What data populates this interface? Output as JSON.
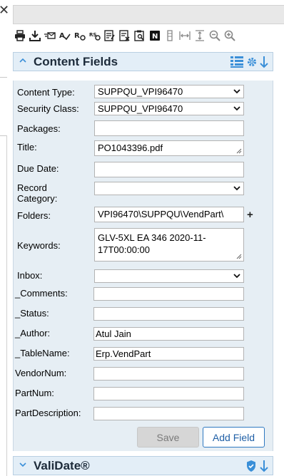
{
  "window": {
    "close_glyph": "✕"
  },
  "toolbar": {
    "icons": [
      "print-icon",
      "download-icon",
      "email-icon",
      "spellcheck-icon",
      "redirect-icon",
      "route-icon",
      "form-icon",
      "close-form-icon",
      "clipboard-search-icon",
      "notes-icon",
      "column-icon",
      "fit-width-icon",
      "fit-height-icon",
      "zoom-out-icon",
      "zoom-in-icon"
    ]
  },
  "content_fields": {
    "title": "Content Fields",
    "chev": "^",
    "fields": {
      "content_type": {
        "label": "Content Type:",
        "value": "SUPPQU_VPI96470"
      },
      "security_class": {
        "label": "Security Class:",
        "value": "SUPPQU_VPI96470"
      },
      "packages": {
        "label": "Packages:",
        "value": ""
      },
      "title": {
        "label": "Title:",
        "value": "PO1043396.pdf"
      },
      "due_date": {
        "label": "Due Date:",
        "value": ""
      },
      "record_category": {
        "label_1": "Record",
        "label_2": "Category:",
        "value": ""
      },
      "folders": {
        "label": "Folders:",
        "value": "VPI96470\\SUPPQU\\VendPart\\",
        "add": "+"
      },
      "keywords": {
        "label": "Keywords:",
        "line_1": "GLV-5XL  EA 346 2020-11-",
        "line_2": "17T00:00:00"
      },
      "inbox": {
        "label": "Inbox:",
        "value": ""
      },
      "comments": {
        "label": "_Comments:",
        "value": ""
      },
      "status": {
        "label": "_Status:",
        "value": ""
      },
      "author": {
        "label": "_Author:",
        "value": "Atul Jain"
      },
      "table_name": {
        "label": "_TableName:",
        "value": "Erp.VendPart"
      },
      "vendor_num": {
        "label": "VendorNum:",
        "value": ""
      },
      "part_num": {
        "label": "PartNum:",
        "value": ""
      },
      "part_description": {
        "label": "PartDescription:",
        "value": ""
      }
    },
    "buttons": {
      "save": "Save",
      "add_field": "Add Field"
    }
  },
  "validate": {
    "title": "ValiDate®",
    "chev": "v"
  },
  "colors": {
    "accent": "#3a8fd8",
    "header_bg": "#e3eef7",
    "panel_bg": "#e6eef4"
  }
}
